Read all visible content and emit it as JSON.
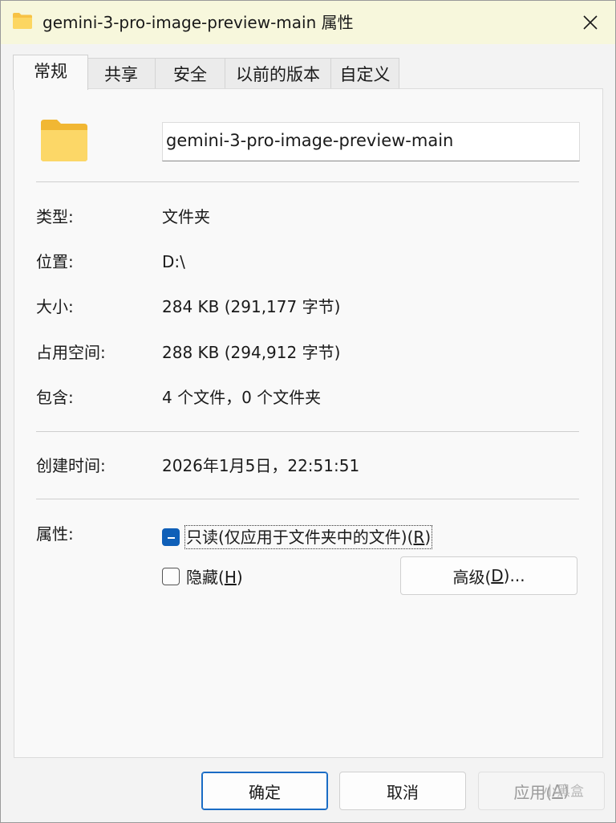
{
  "window": {
    "title": "gemini-3-pro-image-preview-main 属性"
  },
  "tabs": [
    "常规",
    "共享",
    "安全",
    "以前的版本",
    "自定义"
  ],
  "general": {
    "name": "gemini-3-pro-image-preview-main",
    "type_label": "类型:",
    "type_value": "文件夹",
    "location_label": "位置:",
    "location_value": "D:\\",
    "size_label": "大小:",
    "size_value": "284 KB (291,177 字节)",
    "size_on_disk_label": "占用空间:",
    "size_on_disk_value": "288 KB (294,912 字节)",
    "contains_label": "包含:",
    "contains_value": "4 个文件，0 个文件夹",
    "created_label": "创建时间:",
    "created_value": "2026年1月5日，22:51:51",
    "attributes_label": "属性:",
    "readonly_label_prefix": "只读(仅应用于文件夹中的文件)(",
    "readonly_accel": "R",
    "readonly_label_suffix": ")",
    "readonly_state": "indeterminate",
    "hidden_label_prefix": "隐藏(",
    "hidden_accel": "H",
    "hidden_label_suffix": ")",
    "hidden_state": "unchecked",
    "advanced_prefix": "高级(",
    "advanced_accel": "D",
    "advanced_suffix": ")..."
  },
  "footer": {
    "ok": "确定",
    "cancel": "取消",
    "apply_prefix": "应用(",
    "apply_accel": "A",
    "apply_suffix": ")"
  },
  "watermark": "小黑盒",
  "colors": {
    "titlebar": "#f7f7dc",
    "accent": "#0f5fb8",
    "folder": "#f8c94a"
  }
}
